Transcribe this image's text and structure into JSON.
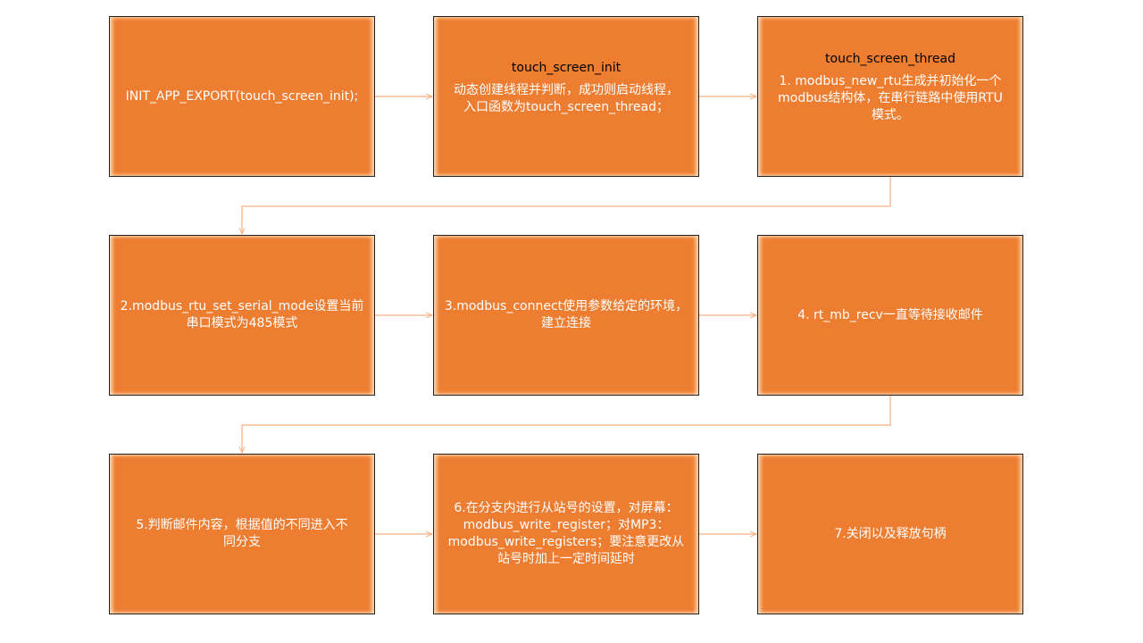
{
  "colors": {
    "box_fill": "#ed7d31",
    "box_border": "#222222",
    "connector": "#f4b183"
  },
  "steps": [
    {
      "title": "",
      "text": "INIT_APP_EXPORT(touch_screen_init);"
    },
    {
      "title": "touch_screen_init",
      "text": "动态创建线程并判断，成功则启动线程，\n入口函数为touch_screen_thread；"
    },
    {
      "title": "touch_screen_thread",
      "text": "1. modbus_new_rtu生成并初始化一个\nmodbus结构体，在串行链路中使用RTU\n模式。"
    },
    {
      "title": "",
      "text": "2.modbus_rtu_set_serial_mode设置当前\n串口模式为485模式"
    },
    {
      "title": "",
      "text": "3.modbus_connect使用参数给定的环境，\n建立连接"
    },
    {
      "title": "",
      "text": "4. rt_mb_recv一直等待接收邮件"
    },
    {
      "title": "",
      "text": "5.判断邮件内容，根据值的不同进入不\n同分支"
    },
    {
      "title": "",
      "text": "6.在分支内进行从站号的设置，对屏幕：\nmodbus_write_register；对MP3：\nmodbus_write_registers；要注意更改从\n站号时加上一定时间延时"
    },
    {
      "title": "",
      "text": "7.关闭以及释放句柄"
    }
  ]
}
